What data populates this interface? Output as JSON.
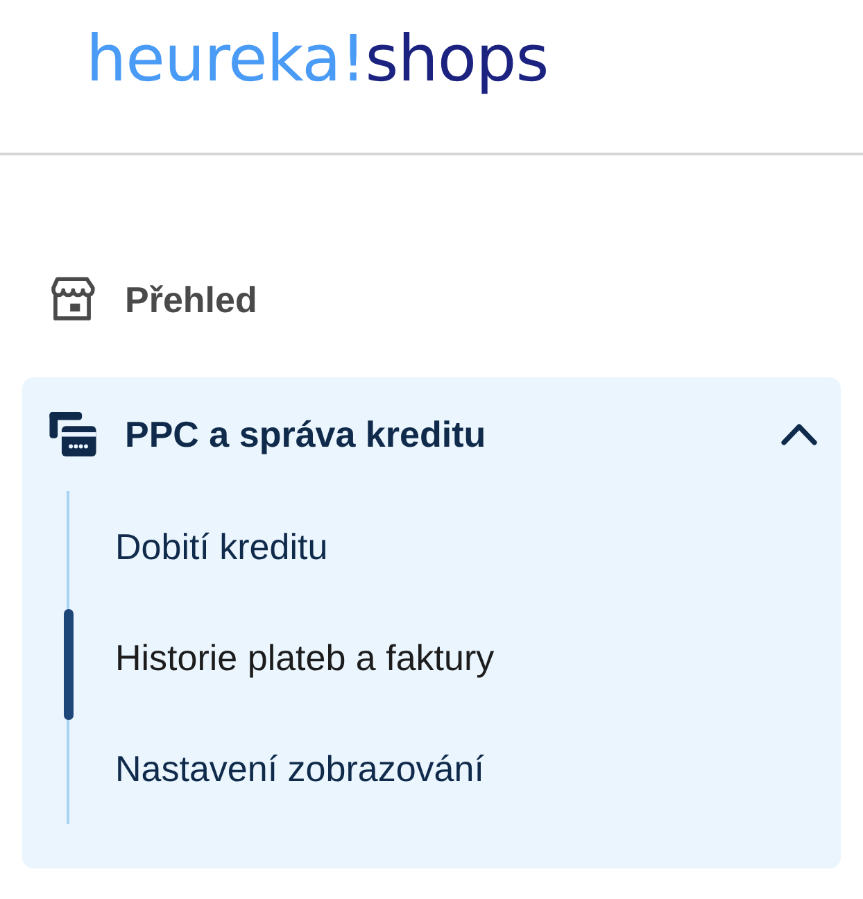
{
  "logo": {
    "brand": "heureka!",
    "product": "shops"
  },
  "nav": {
    "items": [
      {
        "kind": "link",
        "label": "Přehled",
        "selected": false
      },
      {
        "kind": "group",
        "label": "PPC a správa kreditu",
        "expanded": true,
        "children": [
          {
            "label": "Dobití kreditu",
            "selected": false
          },
          {
            "label": "Historie plateb a faktury",
            "selected": true
          },
          {
            "label": "Nastavení zobrazování",
            "selected": false
          }
        ]
      }
    ]
  }
}
